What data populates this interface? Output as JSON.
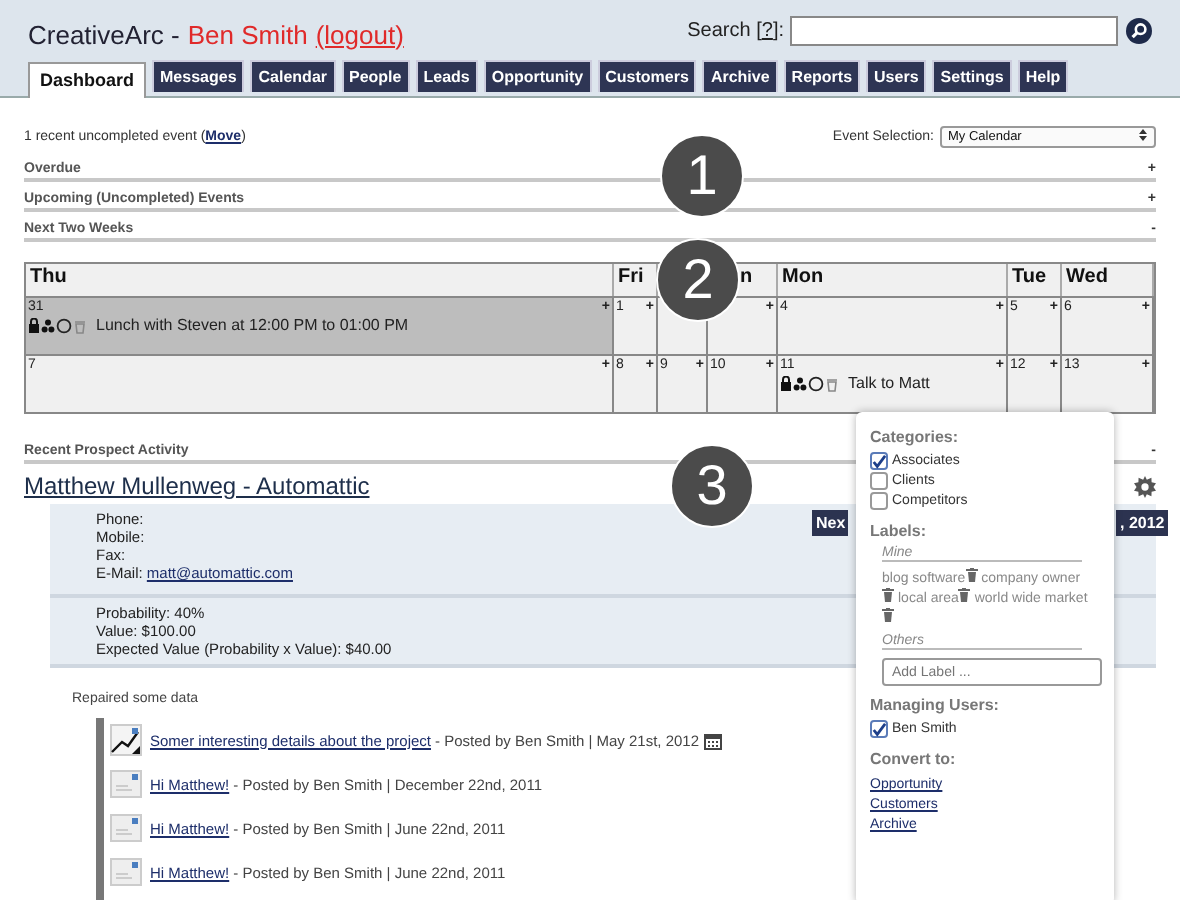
{
  "header": {
    "app_name": "CreativeArc -",
    "user": "Ben Smith",
    "logout": "(logout)",
    "search_label": "Search [",
    "search_help": "?",
    "search_label_end": "]:"
  },
  "tabs": [
    {
      "label": "Dashboard",
      "selected": true
    },
    {
      "label": "Messages",
      "selected": false
    },
    {
      "label": "Calendar",
      "selected": false
    },
    {
      "label": "People",
      "selected": false
    },
    {
      "label": "Leads",
      "selected": false
    },
    {
      "label": "Opportunity",
      "selected": false
    },
    {
      "label": "Customers",
      "selected": false
    },
    {
      "label": "Archive",
      "selected": false
    },
    {
      "label": "Reports",
      "selected": false
    },
    {
      "label": "Users",
      "selected": false
    },
    {
      "label": "Settings",
      "selected": false
    },
    {
      "label": "Help",
      "selected": false
    }
  ],
  "notice": {
    "text": "1 recent uncompleted event (",
    "link": "Move",
    "end": ")"
  },
  "event_selection": {
    "label": "Event Selection:",
    "value": "My Calendar"
  },
  "sections": [
    {
      "label": "Overdue",
      "toggle": "+"
    },
    {
      "label": "Upcoming (Uncompleted) Events",
      "toggle": "+"
    },
    {
      "label": "Next Two Weeks",
      "toggle": "-"
    }
  ],
  "calendar": {
    "columns": [
      {
        "label": "Thu"
      },
      {
        "label": "Fri"
      },
      {},
      {
        "label": "n"
      },
      {
        "label": "Mon"
      },
      {
        "label": "Tue"
      },
      {
        "label": "Wed"
      }
    ],
    "weeks": [
      {
        "days": [
          {
            "date": "31",
            "plus": "+",
            "highlighted": true,
            "events": [
              {
                "title": "Lunch with Steven at 12:00 PM to 01:00 PM"
              }
            ]
          },
          {
            "date": "1",
            "plus": "+",
            "highlighted": false
          },
          {
            "highlighted": false
          },
          {
            "plus": "+",
            "highlighted": false
          },
          {
            "date": "4",
            "plus": "+",
            "highlighted": false
          },
          {
            "date": "5",
            "plus": "+",
            "highlighted": false
          },
          {
            "date": "6",
            "plus": "+",
            "highlighted": false
          }
        ]
      },
      {
        "days": [
          {
            "date": "7",
            "plus": "+",
            "highlighted": false
          },
          {
            "date": "8",
            "plus": "+",
            "highlighted": false
          },
          {
            "date": "9",
            "plus": "+",
            "highlighted": false
          },
          {
            "date": "10",
            "plus": "+",
            "highlighted": false
          },
          {
            "date": "11",
            "plus": "+",
            "highlighted": false,
            "events": [
              {
                "title": "Talk to Matt"
              }
            ]
          },
          {
            "date": "12",
            "plus": "+",
            "highlighted": false
          },
          {
            "date": "13",
            "plus": "+",
            "highlighted": false
          }
        ]
      }
    ]
  },
  "recent_section": {
    "label": "Recent Prospect Activity",
    "toggle": "-"
  },
  "prospect": {
    "name": "Matthew Mullenweg - Automattic",
    "next_button": "Nex",
    "date_fragment": ", 2012",
    "contact": [
      {
        "label": "Phone:"
      },
      {
        "label": "Mobile:"
      },
      {
        "label": "Fax:"
      },
      {
        "label": "E-Mail:",
        "link": "matt@automattic.com"
      }
    ],
    "deal": [
      "Probability: 40%",
      "Value: $100.00",
      "Expected Value (Probability x Value): $40.00"
    ],
    "note": "Repaired some data",
    "posts": [
      {
        "kind": "chart",
        "title": "Somer interesting details about the project",
        "meta": "- Posted by Ben Smith | May 21st, 2012",
        "calendar_icon": true
      },
      {
        "kind": "note",
        "title": "Hi Matthew!",
        "meta": "- Posted by Ben Smith | December 22nd, 2011",
        "calendar_icon": false
      },
      {
        "kind": "note",
        "title": "Hi Matthew!",
        "meta": "- Posted by Ben Smith | June 22nd, 2011",
        "calendar_icon": false
      },
      {
        "kind": "note",
        "title": "Hi Matthew!",
        "meta": "- Posted by Ben Smith | June 22nd, 2011",
        "calendar_icon": false
      }
    ]
  },
  "side_panel": {
    "categories_title": "Categories:",
    "categories": [
      {
        "label": "Associates",
        "checked": true
      },
      {
        "label": "Clients",
        "checked": false
      },
      {
        "label": "Competitors",
        "checked": false
      }
    ],
    "labels_title": "Labels:",
    "mine": "Mine",
    "labels": [
      "blog software",
      "company owner",
      "local area",
      "world wide market"
    ],
    "others": "Others",
    "add_placeholder": "Add Label ...",
    "managing_title": "Managing Users:",
    "managers": [
      {
        "label": "Ben Smith",
        "checked": true
      }
    ],
    "convert_title": "Convert to:",
    "convert_links": [
      "Opportunity",
      "Customers",
      "Archive"
    ]
  },
  "markers": [
    {
      "label": "1"
    },
    {
      "label": "2"
    },
    {
      "label": "3"
    }
  ]
}
